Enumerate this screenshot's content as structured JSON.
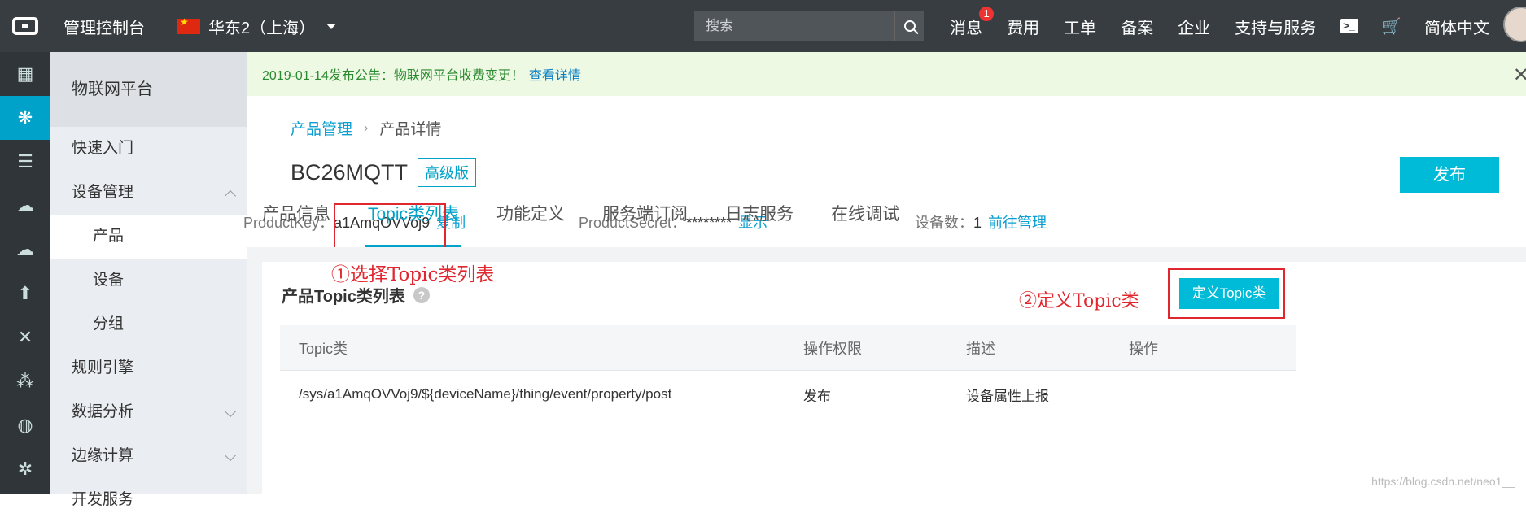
{
  "topbar": {
    "title": "管理控制台",
    "region": "华东2（上海）",
    "search_placeholder": "搜索",
    "links": [
      "消息",
      "费用",
      "工单",
      "备案",
      "企业",
      "支持与服务"
    ],
    "message_badge": "1",
    "language": "简体中文"
  },
  "rail": {
    "icons": [
      "grid-icon",
      "iot-icon",
      "server-icon",
      "cloud-brain-icon",
      "cloud-icon",
      "cloud-upload-icon",
      "cross-icon",
      "nodes-icon",
      "globe-icon",
      "bug-icon"
    ]
  },
  "sidebar": {
    "header": "物联网平台",
    "items": [
      {
        "label": "快速入门"
      },
      {
        "label": "设备管理"
      },
      {
        "label": "产品"
      },
      {
        "label": "设备"
      },
      {
        "label": "分组"
      },
      {
        "label": "规则引擎"
      },
      {
        "label": "数据分析"
      },
      {
        "label": "边缘计算"
      },
      {
        "label": "开发服务"
      }
    ]
  },
  "notice": {
    "text": "2019-01-14发布公告：物联网平台收费变更！",
    "link": "查看详情"
  },
  "breadcrumb": {
    "parent": "产品管理",
    "current": "产品详情"
  },
  "product": {
    "name": "BC26MQTT",
    "edition": "高级版",
    "publish_label": "发布",
    "product_key_label": "ProductKey：",
    "product_key": "a1AmqOVVoj9",
    "copy_label": "复制",
    "product_secret_label": "ProductSecret：",
    "product_secret": "********",
    "show_label": "显示",
    "device_count_label": "设备数：",
    "device_count": "1",
    "manage_label": "前往管理"
  },
  "tabs": [
    "产品信息",
    "Topic类列表",
    "功能定义",
    "服务端订阅",
    "日志服务",
    "在线调试"
  ],
  "annotations": {
    "step1": "①选择Topic类列表",
    "step2": "②定义Topic类"
  },
  "topic_section": {
    "title": "产品Topic类列表",
    "define_button": "定义Topic类",
    "columns": [
      "Topic类",
      "操作权限",
      "描述",
      "操作"
    ],
    "rows": [
      {
        "topic": "/sys/a1AmqOVVoj9/${deviceName}/thing/event/property/post",
        "permission": "发布",
        "desc": "设备属性上报",
        "action": ""
      }
    ]
  },
  "watermark": "https://blog.csdn.net/neo1__"
}
